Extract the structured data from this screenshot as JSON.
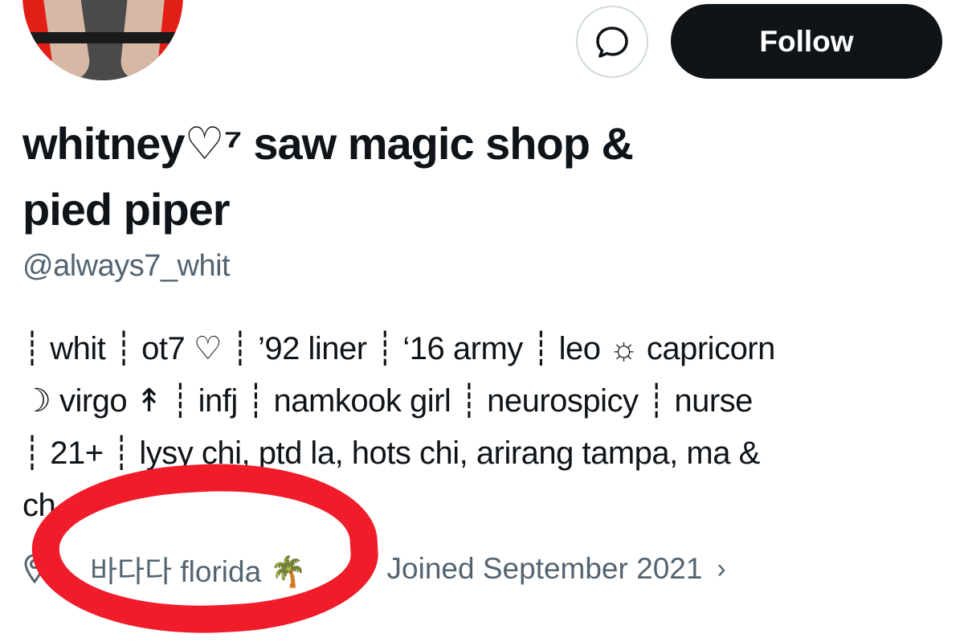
{
  "profile": {
    "follow_label": "Follow",
    "display_name_line1": "whitney♡⁷ saw magic shop &",
    "display_name_line2": "pied piper",
    "handle": "@always7_whit",
    "bio": "┊ whit ┊ ot7 ♡ ┊ ’92 liner ┊ ‘16 army ┊ leo ☼ capricorn\n☽ virgo ↟ ┊ infj ┊ namkook girl ┊ neurospicy ┊ nurse\n┊ 21+ ┊ lysy chi, ptd la, hots chi, arirang tampa, ma &\nch",
    "location": "바다다 florida 🌴",
    "joined": "Joined September 2021",
    "joined_chevron": "›"
  },
  "icons": {
    "message": "message-bubble-icon",
    "location": "location-pin-icon"
  },
  "colors": {
    "follow_bg": "#0f1419",
    "secondary_text": "#536471",
    "annotation_circle": "#f01c2a",
    "avatar_bg": "#e21f16"
  }
}
